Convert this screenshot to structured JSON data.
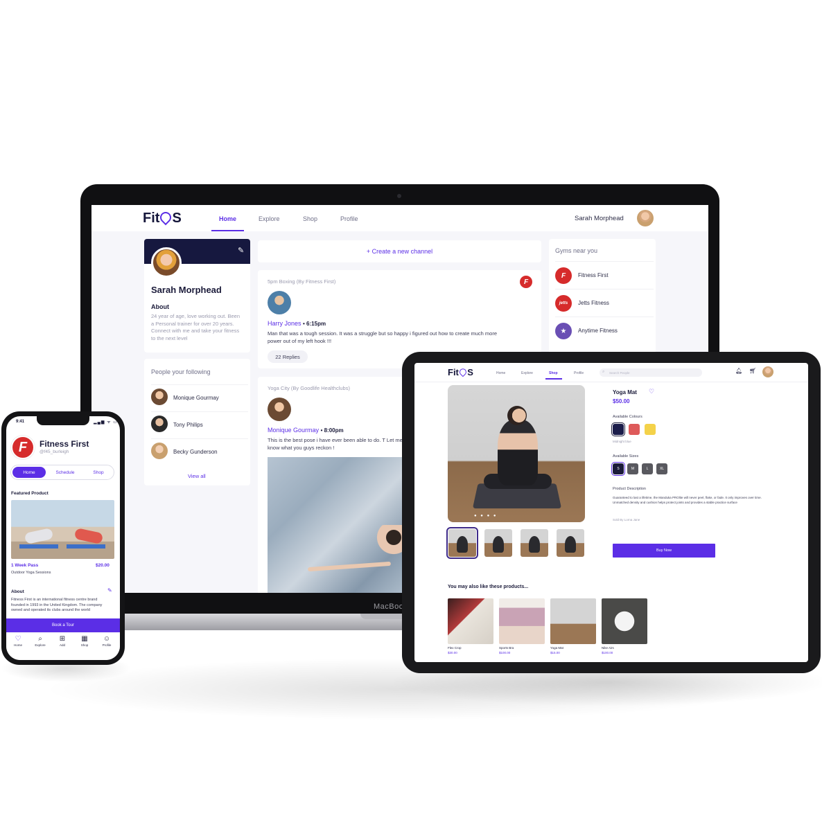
{
  "colors": {
    "accent": "#5b2ee6",
    "navy": "#16183f",
    "brand_red": "#d62b2b"
  },
  "laptop": {
    "brand_label": "MacBook",
    "logo": {
      "part1": "Fit",
      "part2": "S"
    },
    "nav": [
      "Home",
      "Explore",
      "Shop",
      "Profile"
    ],
    "active_nav": "Home",
    "user_name": "Sarah Morphead",
    "profile": {
      "name": "Sarah Morphead",
      "about_label": "About",
      "about_text": "24 year of age, love working out. Been a Personal trainer for over 20 years. Connect with me and take your fitness to the next level"
    },
    "following": {
      "title": "People your following",
      "people": [
        "Monique  Gourmay",
        "Tony Philips",
        "Becky Gunderson"
      ],
      "view_all": "View all"
    },
    "create_channel": "+ Create a new channel",
    "posts": [
      {
        "meta": "5pm Boxing (By Fitness First)",
        "author": "Harry Jones",
        "time": "• 6:15pm",
        "body": "Man that was a tough session. It was a struggle but so happy i figured out how to create much more power out of my left hook !!!",
        "replies": "22 Replies"
      },
      {
        "meta": "Yoga City (By Goodlife Healthclubs)",
        "author": "Monique Gourmay",
        "time": "• 8:00pm",
        "body": "This is the best pose i have ever been able to do. T Let me know what you guys reckon !"
      }
    ],
    "gyms": {
      "title": "Gyms near you",
      "items": [
        "Fitness First",
        "Jetts Fitness",
        "Anytime Fitness"
      ]
    }
  },
  "tablet": {
    "logo": {
      "part1": "Fit",
      "part2": "S"
    },
    "nav": [
      "Home",
      "Explore",
      "Shop",
      "Profile"
    ],
    "active_nav": "Shop",
    "search_placeholder": "Search People",
    "product": {
      "name": "Yoga Mat",
      "price": "$50.00",
      "colours_label": "Available Colours",
      "colours": [
        "#1b1d4a",
        "#de5a5a",
        "#f4d24a"
      ],
      "selected_colour_name": "Midnight blue",
      "sizes_label": "Available Sizes",
      "sizes": [
        "S",
        "M",
        "L",
        "XL"
      ],
      "selected_size": "S",
      "description_label": "Product Description",
      "description": "Guaranteed to last a lifetime, the Manduka PROlite will never peel, flake, or fade. It only improves over time. Unmatched density and cushion helps protect joints and provides a stable practice surface",
      "seller": "Sold By Lorna Jane",
      "buy_label": "Buy Now",
      "image_dots": "● ● ● ●"
    },
    "related_title": "You may also like these products...",
    "related": [
      {
        "name": "Flex Crop",
        "price": "$30.00"
      },
      {
        "name": "Sports Bra",
        "price": "$100.00"
      },
      {
        "name": "Yoga Mat",
        "price": "$15.00"
      },
      {
        "name": "Nike Airs",
        "price": "$100.00"
      }
    ]
  },
  "phone": {
    "time": "9:41",
    "status_icons": "▂▄▆ ᯤ ▭",
    "gym_name": "Fitness First",
    "handle": "@f45_burleigh",
    "tabs": [
      "Home",
      "Schedule",
      "Shop"
    ],
    "active_tab": "Home",
    "featured_label": "Featured Product",
    "pass_name": "1 Week Pass",
    "pass_price": "$20.00",
    "pass_sub": "Outdoor Yoga Sessions",
    "about_label": "About",
    "about_text": "Fitness First is an international fitness centre brand founded in 1993 in the United Kingdom. The company owned and operated its clubs around the world",
    "book_label": "Book a Tour",
    "bottom_nav": [
      "Home",
      "Explore",
      "Add",
      "Shop",
      "Profile"
    ]
  }
}
